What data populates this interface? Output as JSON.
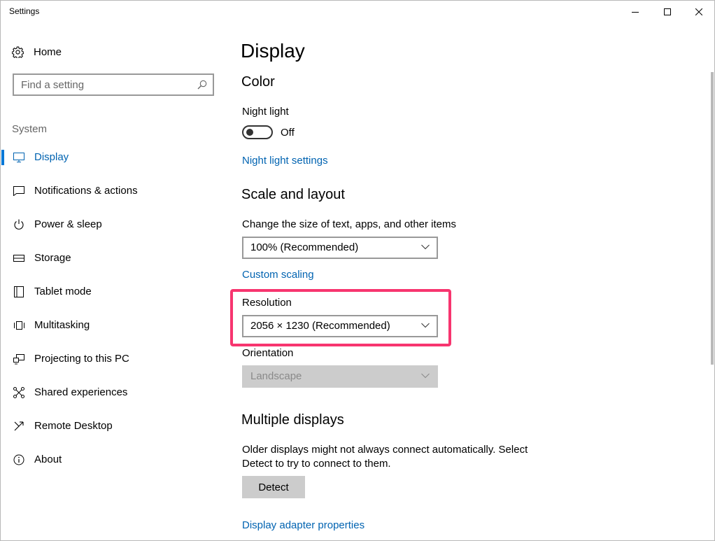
{
  "window": {
    "title": "Settings"
  },
  "sidebar": {
    "home_label": "Home",
    "search_placeholder": "Find a setting",
    "section_label": "System",
    "items": [
      {
        "label": "Display",
        "icon": "monitor-icon",
        "active": true
      },
      {
        "label": "Notifications & actions",
        "icon": "notifications-icon",
        "active": false
      },
      {
        "label": "Power & sleep",
        "icon": "power-icon",
        "active": false
      },
      {
        "label": "Storage",
        "icon": "storage-icon",
        "active": false
      },
      {
        "label": "Tablet mode",
        "icon": "tablet-icon",
        "active": false
      },
      {
        "label": "Multitasking",
        "icon": "multitasking-icon",
        "active": false
      },
      {
        "label": "Projecting to this PC",
        "icon": "projecting-icon",
        "active": false
      },
      {
        "label": "Shared experiences",
        "icon": "shared-experiences-icon",
        "active": false
      },
      {
        "label": "Remote Desktop",
        "icon": "remote-desktop-icon",
        "active": false
      },
      {
        "label": "About",
        "icon": "info-icon",
        "active": false
      }
    ]
  },
  "main": {
    "page_title": "Display",
    "color": {
      "heading": "Color",
      "night_light_label": "Night light",
      "night_light_state": "Off",
      "night_light_on": false,
      "night_light_settings_link": "Night light settings"
    },
    "scale_layout": {
      "heading": "Scale and layout",
      "size_label": "Change the size of text, apps, and other items",
      "size_value": "100% (Recommended)",
      "custom_scaling_link": "Custom scaling",
      "resolution_label": "Resolution",
      "resolution_value": "2056 × 1230 (Recommended)",
      "orientation_label": "Orientation",
      "orientation_value": "Landscape",
      "orientation_disabled": true
    },
    "multiple_displays": {
      "heading": "Multiple displays",
      "description_line1": "Older displays might not always connect automatically. Select",
      "description_line2": "Detect to try to connect to them.",
      "detect_button": "Detect",
      "adapter_link": "Display adapter properties"
    }
  },
  "colors": {
    "accent": "#0078d7",
    "link": "#0063b1",
    "highlight": "#f7356f"
  }
}
